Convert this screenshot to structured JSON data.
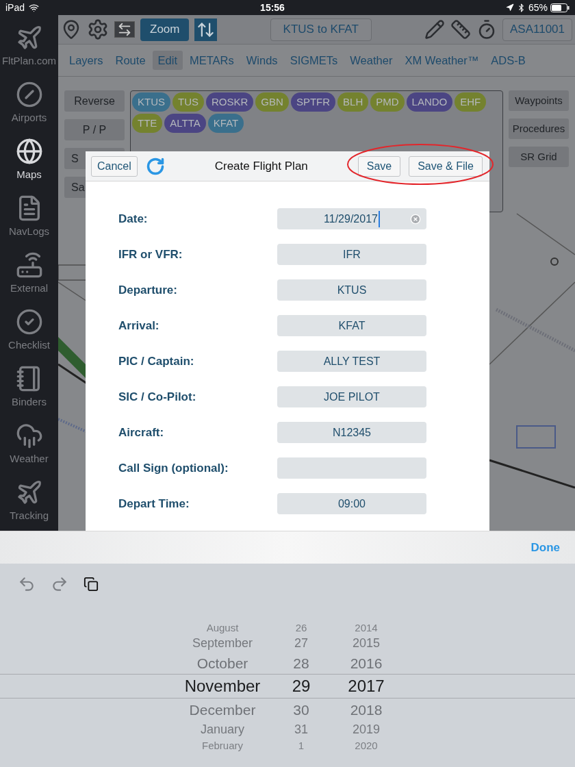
{
  "status_bar": {
    "device": "iPad",
    "time": "15:56",
    "battery": "65%"
  },
  "sidebar": {
    "items": [
      {
        "label": "FltPlan.com",
        "selected": false
      },
      {
        "label": "Airports",
        "selected": false
      },
      {
        "label": "Maps",
        "selected": true
      },
      {
        "label": "NavLogs",
        "selected": false
      },
      {
        "label": "External",
        "selected": false
      },
      {
        "label": "Checklist",
        "selected": false
      },
      {
        "label": "Binders",
        "selected": false
      },
      {
        "label": "Weather",
        "selected": false
      },
      {
        "label": "Tracking",
        "selected": false
      }
    ]
  },
  "toolbar": {
    "zoom": {
      "label": "Zoom",
      "selected": true
    },
    "route_button": "KTUS to KFAT",
    "aircraft_button": "ASA11001"
  },
  "tabs": [
    {
      "label": "Layers",
      "selected": false
    },
    {
      "label": "Route",
      "selected": false
    },
    {
      "label": "Edit",
      "selected": true
    },
    {
      "label": "METARs",
      "selected": false
    },
    {
      "label": "Winds",
      "selected": false
    },
    {
      "label": "SIGMETs",
      "selected": false
    },
    {
      "label": "Weather",
      "selected": false
    },
    {
      "label": "XM Weather™",
      "selected": false
    },
    {
      "label": "ADS-B",
      "selected": false
    }
  ],
  "left_buttons": [
    {
      "label": "Reverse",
      "kind": "full"
    },
    {
      "label": "P / P",
      "kind": "full"
    },
    {
      "label": "S",
      "kind": "partial"
    },
    {
      "label": "Sa",
      "kind": "partial"
    }
  ],
  "route": [
    {
      "label": "KTUS",
      "color": "#3a6f8c"
    },
    {
      "label": "TUS",
      "color": "#74822f"
    },
    {
      "label": "ROSKR",
      "color": "#4b4583"
    },
    {
      "label": "GBN",
      "color": "#74822f"
    },
    {
      "label": "SPTFR",
      "color": "#4b4583"
    },
    {
      "label": "BLH",
      "color": "#74822f"
    },
    {
      "label": "PMD",
      "color": "#74822f"
    },
    {
      "label": "LANDO",
      "color": "#4b4583"
    },
    {
      "label": "EHF",
      "color": "#74822f"
    },
    {
      "label": "TTE",
      "color": "#74822f"
    },
    {
      "label": "ALTTA",
      "color": "#4b4583"
    },
    {
      "label": "KFAT",
      "color": "#3a6f8c"
    }
  ],
  "right_buttons": [
    "Waypoints",
    "Procedures",
    "SR Grid"
  ],
  "dialog": {
    "title": "Create Flight Plan",
    "cancel": "Cancel",
    "save": "Save",
    "save_file": "Save & File",
    "fields": [
      {
        "label": "Date:",
        "value": "11/29/2017",
        "focused": true
      },
      {
        "label": "IFR or VFR:",
        "value": "IFR",
        "focused": false
      },
      {
        "label": "Departure:",
        "value": "KTUS",
        "focused": false
      },
      {
        "label": "Arrival:",
        "value": "KFAT",
        "focused": false
      },
      {
        "label": "PIC / Captain:",
        "value": "ALLY TEST",
        "focused": false
      },
      {
        "label": "SIC / Co-Pilot:",
        "value": "JOE PILOT",
        "focused": false
      },
      {
        "label": "Aircraft:",
        "value": "N12345",
        "focused": false
      },
      {
        "label": "Call Sign (optional):",
        "focused": false
      },
      {
        "label": "Depart Time:",
        "value": "09:00",
        "focused": false
      }
    ]
  },
  "keyboard": {
    "done": "Done",
    "picker": {
      "columns": [
        [
          {
            "label": "August",
            "selected": false
          },
          {
            "label": "September",
            "selected": false
          },
          {
            "label": "October",
            "selected": false
          },
          {
            "label": "November",
            "selected": true
          },
          {
            "label": "December",
            "selected": false
          },
          {
            "label": "January",
            "selected": false
          },
          {
            "label": "February",
            "selected": false
          }
        ],
        [
          {
            "label": "26",
            "selected": false
          },
          {
            "label": "27",
            "selected": false
          },
          {
            "label": "28",
            "selected": false
          },
          {
            "label": "29",
            "selected": true
          },
          {
            "label": "30",
            "selected": false
          },
          {
            "label": "31",
            "selected": false
          },
          {
            "label": "1",
            "selected": false
          }
        ],
        [
          {
            "label": "2014",
            "selected": false
          },
          {
            "label": "2015",
            "selected": false
          },
          {
            "label": "2016",
            "selected": false
          },
          {
            "label": "2017",
            "selected": true
          },
          {
            "label": "2018",
            "selected": false
          },
          {
            "label": "2019",
            "selected": false
          },
          {
            "label": "2020",
            "selected": false
          }
        ]
      ]
    }
  }
}
